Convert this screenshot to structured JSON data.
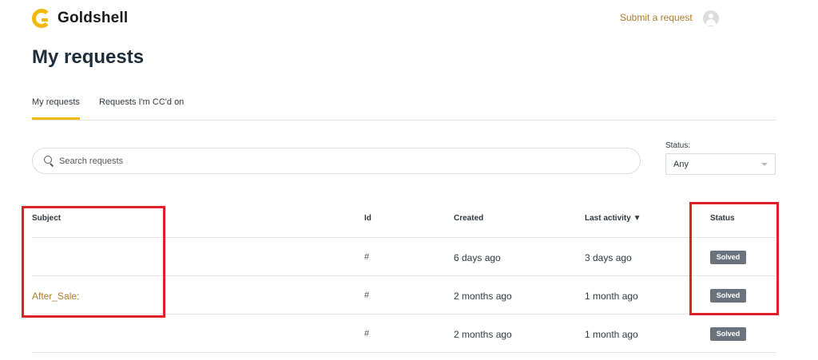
{
  "header": {
    "brand": "Goldshell",
    "submit_request": "Submit a request"
  },
  "page_title": "My requests",
  "tabs": [
    {
      "label": "My requests",
      "active": true
    },
    {
      "label": "Requests I'm CC'd on",
      "active": false
    }
  ],
  "search": {
    "placeholder": "Search requests",
    "value": ""
  },
  "status_filter": {
    "label": "Status:",
    "selected": "Any"
  },
  "table": {
    "columns": [
      "Subject",
      "Id",
      "Created",
      "Last activity ▼",
      "Status"
    ],
    "rows": [
      {
        "subject": "",
        "id": "#",
        "created": "6 days ago",
        "last_activity": "3 days ago",
        "status": "Solved"
      },
      {
        "subject": "After_Sale:",
        "id": "#",
        "created": "2 months ago",
        "last_activity": "1 month ago",
        "status": "Solved"
      },
      {
        "subject": "",
        "id": "#",
        "created": "2 months ago",
        "last_activity": "1 month ago",
        "status": "Solved"
      }
    ]
  },
  "colors": {
    "accent": "#f0b90b",
    "link": "#b07a2a",
    "badge": "#68737d",
    "highlight": "#e02027"
  }
}
